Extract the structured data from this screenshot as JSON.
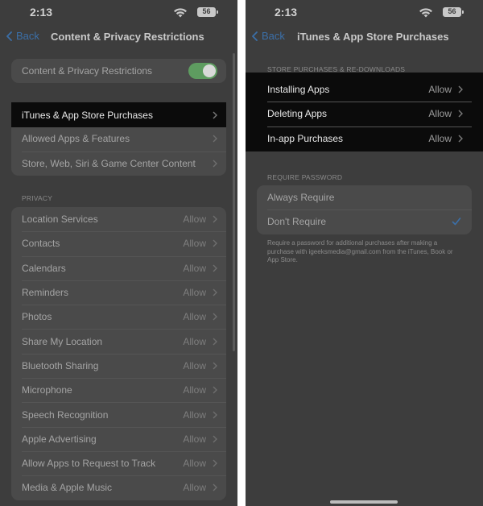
{
  "left": {
    "status": {
      "time": "2:13",
      "battery": "56"
    },
    "nav": {
      "back_label": "Back",
      "title": "Content & Privacy Restrictions"
    },
    "toggle_row": {
      "label": "Content & Privacy Restrictions",
      "on": true
    },
    "highlighted_row": {
      "label": "iTunes & App Store Purchases"
    },
    "store_rows": [
      {
        "label": "Allowed Apps & Features"
      },
      {
        "label": "Store, Web, Siri & Game Center Content"
      }
    ],
    "privacy_header": "PRIVACY",
    "privacy_rows": [
      {
        "label": "Location Services",
        "value": "Allow"
      },
      {
        "label": "Contacts",
        "value": "Allow"
      },
      {
        "label": "Calendars",
        "value": "Allow"
      },
      {
        "label": "Reminders",
        "value": "Allow"
      },
      {
        "label": "Photos",
        "value": "Allow"
      },
      {
        "label": "Share My Location",
        "value": "Allow"
      },
      {
        "label": "Bluetooth Sharing",
        "value": "Allow"
      },
      {
        "label": "Microphone",
        "value": "Allow"
      },
      {
        "label": "Speech Recognition",
        "value": "Allow"
      },
      {
        "label": "Apple Advertising",
        "value": "Allow"
      },
      {
        "label": "Allow Apps to Request to Track",
        "value": "Allow"
      },
      {
        "label": "Media & Apple Music",
        "value": "Allow"
      }
    ]
  },
  "right": {
    "status": {
      "time": "2:13",
      "battery": "56"
    },
    "nav": {
      "back_label": "Back",
      "title": "iTunes & App Store Purchases"
    },
    "purchases_header": "STORE PURCHASES & RE-DOWNLOADS",
    "purchases_rows": [
      {
        "label": "Installing Apps",
        "value": "Allow"
      },
      {
        "label": "Deleting Apps",
        "value": "Allow"
      },
      {
        "label": "In-app Purchases",
        "value": "Allow"
      }
    ],
    "password_header": "REQUIRE PASSWORD",
    "password_rows": [
      {
        "label": "Always Require",
        "selected": false
      },
      {
        "label": "Don't Require",
        "selected": true
      }
    ],
    "password_footer": "Require a password for additional purchases after making a purchase with igeeksmedia@gmail.com from the iTunes, Book or App Store."
  },
  "colors": {
    "accent": "#3b6fa8",
    "toggle_on": "#5e9c60",
    "highlight_bg": "#0b0b0b"
  }
}
